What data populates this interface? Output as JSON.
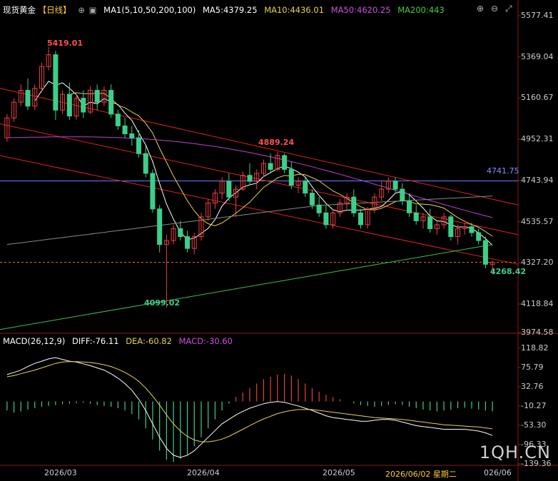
{
  "header": {
    "symbol": "现货黄金",
    "period": "【日线】",
    "ma_label": "MA1(5,10,50,200,100)",
    "ma5": "MA5:4379.25",
    "ma10": "MA10:4436.01",
    "ma50": "MA50:4620.25",
    "ma200": "MA200:443"
  },
  "macd_header": {
    "label": "MACD(26,12,9)",
    "diff": "DIFF:-76.11",
    "dea": "DEA:-60.82",
    "macd": "MACD:-30.60"
  },
  "price_axis": [
    "5577.41",
    "5369.04",
    "5160.67",
    "4952.31",
    "4743.94",
    "4535.57",
    "4327.20",
    "4118.84",
    "3974.58"
  ],
  "macd_axis": [
    "118.82",
    "75.79",
    "32.76",
    "-10.27",
    "-53.30",
    "-96.33",
    "-139.36"
  ],
  "x_labels": [
    "2026/03",
    "2026/04",
    "2026/05",
    "2026/06/02 星期二",
    "026/06"
  ],
  "annotations": {
    "high": "5419.01",
    "mid_high": "4889.24",
    "low": "4099.02",
    "recent_low": "4268.42",
    "hline": "4741.75"
  },
  "watermark": "1QH.CN",
  "colors": {
    "up": "#e84040",
    "down": "#3ccf8a",
    "ma5": "#ffffff",
    "ma10": "#e6d44a",
    "ma50": "#c040d0",
    "ma200": "#40c040",
    "ma100": "#888888",
    "hline": "#6a7cff"
  },
  "chart_data": {
    "type": "candlestick",
    "ylim": [
      3974.58,
      5577.41
    ],
    "macd_ylim": [
      -139.36,
      118.82
    ],
    "candles": [
      [
        4960,
        5080,
        4940,
        5060
      ],
      [
        5060,
        5160,
        5040,
        5140
      ],
      [
        5140,
        5230,
        5120,
        5200
      ],
      [
        5200,
        5260,
        5100,
        5120
      ],
      [
        5120,
        5230,
        5100,
        5210
      ],
      [
        5210,
        5340,
        5190,
        5320
      ],
      [
        5320,
        5420,
        5300,
        5380
      ],
      [
        5380,
        5400,
        5050,
        5100
      ],
      [
        5100,
        5200,
        5080,
        5180
      ],
      [
        5180,
        5240,
        5050,
        5070
      ],
      [
        5070,
        5180,
        5050,
        5160
      ],
      [
        5160,
        5200,
        5060,
        5090
      ],
      [
        5090,
        5220,
        5080,
        5200
      ],
      [
        5200,
        5230,
        5100,
        5140
      ],
      [
        5140,
        5220,
        5120,
        5200
      ],
      [
        5200,
        5230,
        5060,
        5080
      ],
      [
        5080,
        5100,
        5000,
        5020
      ],
      [
        5020,
        5060,
        4960,
        4980
      ],
      [
        4980,
        5020,
        4920,
        4960
      ],
      [
        4960,
        5000,
        4860,
        4880
      ],
      [
        4880,
        4920,
        4760,
        4780
      ],
      [
        4780,
        4800,
        4580,
        4600
      ],
      [
        4600,
        4620,
        4380,
        4420
      ],
      [
        4420,
        4470,
        4100,
        4440
      ],
      [
        4440,
        4520,
        4420,
        4500
      ],
      [
        4500,
        4540,
        4440,
        4460
      ],
      [
        4460,
        4490,
        4380,
        4400
      ],
      [
        4400,
        4480,
        4370,
        4460
      ],
      [
        4460,
        4580,
        4440,
        4560
      ],
      [
        4560,
        4650,
        4540,
        4630
      ],
      [
        4630,
        4700,
        4600,
        4680
      ],
      [
        4680,
        4760,
        4650,
        4740
      ],
      [
        4740,
        4780,
        4640,
        4660
      ],
      [
        4660,
        4720,
        4560,
        4700
      ],
      [
        4700,
        4790,
        4690,
        4770
      ],
      [
        4770,
        4830,
        4720,
        4740
      ],
      [
        4740,
        4800,
        4700,
        4780
      ],
      [
        4780,
        4850,
        4760,
        4830
      ],
      [
        4830,
        4880,
        4780,
        4800
      ],
      [
        4800,
        4890,
        4790,
        4870
      ],
      [
        4870,
        4880,
        4780,
        4800
      ],
      [
        4800,
        4840,
        4700,
        4720
      ],
      [
        4720,
        4760,
        4680,
        4740
      ],
      [
        4740,
        4760,
        4660,
        4680
      ],
      [
        4680,
        4700,
        4600,
        4620
      ],
      [
        4620,
        4660,
        4560,
        4580
      ],
      [
        4580,
        4620,
        4500,
        4520
      ],
      [
        4520,
        4600,
        4500,
        4580
      ],
      [
        4580,
        4650,
        4560,
        4630
      ],
      [
        4630,
        4680,
        4600,
        4660
      ],
      [
        4660,
        4700,
        4560,
        4580
      ],
      [
        4580,
        4600,
        4500,
        4520
      ],
      [
        4520,
        4610,
        4500,
        4600
      ],
      [
        4600,
        4680,
        4580,
        4660
      ],
      [
        4660,
        4740,
        4640,
        4700
      ],
      [
        4700,
        4760,
        4680,
        4740
      ],
      [
        4740,
        4760,
        4680,
        4700
      ],
      [
        4700,
        4730,
        4620,
        4640
      ],
      [
        4640,
        4680,
        4560,
        4580
      ],
      [
        4580,
        4620,
        4520,
        4540
      ],
      [
        4540,
        4580,
        4500,
        4560
      ],
      [
        4560,
        4600,
        4480,
        4500
      ],
      [
        4500,
        4540,
        4470,
        4520
      ],
      [
        4520,
        4580,
        4500,
        4560
      ],
      [
        4560,
        4570,
        4440,
        4460
      ],
      [
        4460,
        4520,
        4420,
        4500
      ],
      [
        4500,
        4530,
        4470,
        4510
      ],
      [
        4510,
        4530,
        4460,
        4480
      ],
      [
        4480,
        4500,
        4420,
        4440
      ],
      [
        4440,
        4460,
        4300,
        4320
      ],
      [
        4320,
        4340,
        4268,
        4330
      ]
    ],
    "macd_hist": [
      -20,
      -25,
      -22,
      -18,
      -15,
      -12,
      -10,
      -8,
      -6,
      -5,
      -4,
      -3,
      -5,
      -8,
      -10,
      -12,
      -15,
      -20,
      -28,
      -40,
      -60,
      -85,
      -110,
      -130,
      -135,
      -128,
      -118,
      -100,
      -80,
      -60,
      -40,
      -20,
      -5,
      10,
      20,
      30,
      40,
      50,
      55,
      60,
      62,
      58,
      50,
      40,
      30,
      22,
      15,
      10,
      5,
      0,
      -4,
      -8,
      -10,
      -12,
      -10,
      -8,
      -6,
      -8,
      -12,
      -15,
      -18,
      -20,
      -22,
      -20,
      -18,
      -15,
      -14,
      -16,
      -18,
      -20,
      -22
    ],
    "macd_diff": [
      60,
      65,
      70,
      78,
      85,
      90,
      95,
      98,
      94,
      90,
      88,
      84,
      80,
      75,
      70,
      62,
      52,
      40,
      25,
      5,
      -20,
      -50,
      -80,
      -105,
      -120,
      -125,
      -120,
      -110,
      -95,
      -80,
      -65,
      -50,
      -40,
      -30,
      -22,
      -15,
      -10,
      -5,
      -2,
      0,
      -2,
      -6,
      -10,
      -15,
      -20,
      -26,
      -32,
      -36,
      -38,
      -40,
      -42,
      -44,
      -44,
      -42,
      -40,
      -40,
      -42,
      -46,
      -50,
      -54,
      -56,
      -58,
      -60,
      -62,
      -62,
      -62,
      -62,
      -64,
      -66,
      -70,
      -76
    ],
    "macd_dea": [
      55,
      58,
      62,
      66,
      70,
      75,
      80,
      85,
      88,
      89,
      89,
      88,
      87,
      85,
      82,
      78,
      72,
      65,
      56,
      45,
      30,
      12,
      -8,
      -30,
      -50,
      -66,
      -78,
      -86,
      -90,
      -90,
      -88,
      -84,
      -78,
      -70,
      -62,
      -54,
      -46,
      -39,
      -33,
      -27,
      -23,
      -20,
      -18,
      -18,
      -18,
      -20,
      -22,
      -24,
      -26,
      -28,
      -30,
      -32,
      -34,
      -36,
      -37,
      -38,
      -39,
      -40,
      -42,
      -44,
      -46,
      -48,
      -50,
      -52,
      -53,
      -54,
      -55,
      -56,
      -57,
      -59,
      -61
    ]
  }
}
